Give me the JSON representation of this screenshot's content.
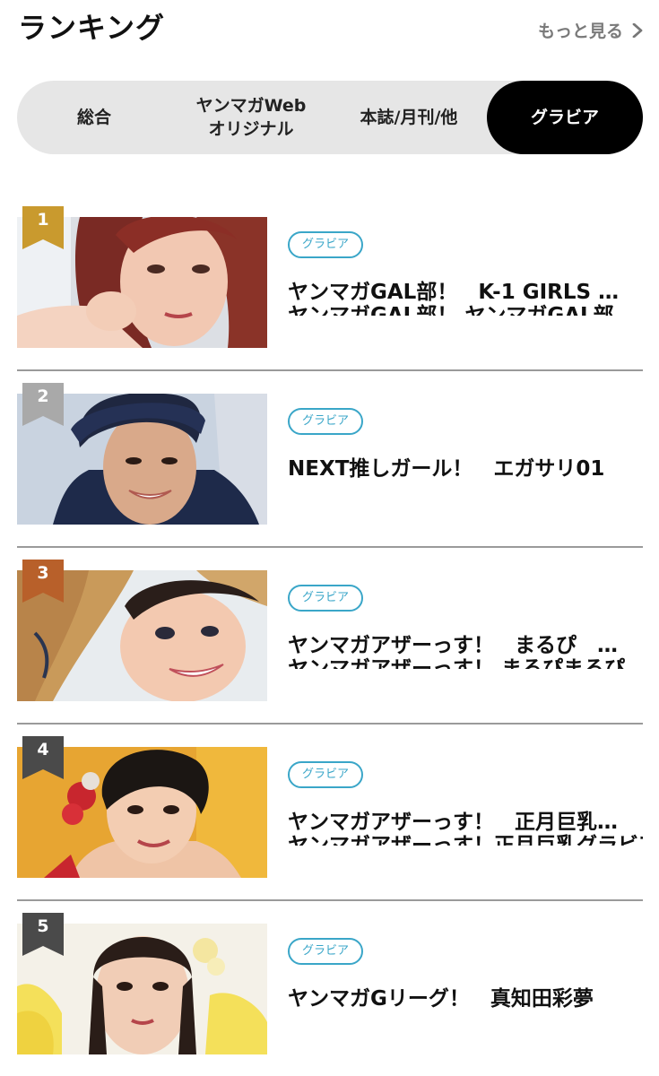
{
  "header": {
    "title": "ランキング",
    "more_label": "もっと見る"
  },
  "tabs": [
    {
      "label": "総合",
      "selected": false
    },
    {
      "label": "ヤンマガWeb\nオリジナル",
      "selected": false
    },
    {
      "label": "本誌/月刊/他",
      "selected": false
    },
    {
      "label": "グラビア",
      "selected": true
    }
  ],
  "ranking": [
    {
      "rank": "1",
      "badge_color": "#c99a2e",
      "category": "グラビア",
      "title": "ヤンマガGAL部！　K-1 GIRLS …",
      "subtitle": "ヤンマガGAL部！ ヤンマガGAL部"
    },
    {
      "rank": "2",
      "badge_color": "#a9a9a9",
      "category": "グラビア",
      "title": "NEXT推しガール！　エガサリ01",
      "subtitle": ""
    },
    {
      "rank": "3",
      "badge_color": "#b8602a",
      "category": "グラビア",
      "title": "ヤンマガアザーっす！　まるぴ　…",
      "subtitle": "ヤンマガアザーっす！ まるぴまるぴ"
    },
    {
      "rank": "4",
      "badge_color": "#4a4a4a",
      "category": "グラビア",
      "title": "ヤンマガアザーっす！　正月巨乳…",
      "subtitle": "ヤンマガアザーっす！正月巨乳グラビア"
    },
    {
      "rank": "5",
      "badge_color": "#4a4a4a",
      "category": "グラビア",
      "title": "ヤンマガGリーグ！　真知田彩夢",
      "subtitle": ""
    }
  ]
}
